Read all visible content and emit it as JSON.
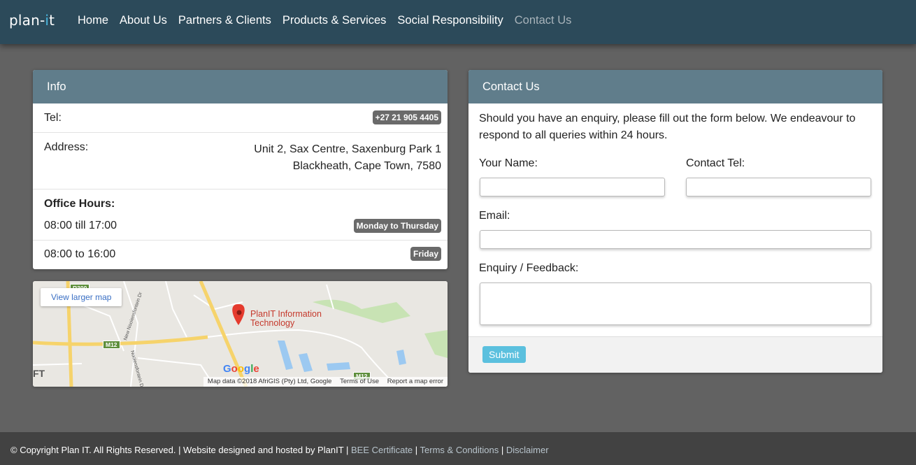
{
  "brand": {
    "logo_text": "plan-",
    "logo_dot": "i",
    "logo_end": "t"
  },
  "nav": [
    {
      "label": "Home"
    },
    {
      "label": "About Us"
    },
    {
      "label": "Partners & Clients"
    },
    {
      "label": "Products & Services"
    },
    {
      "label": "Social Responsibility"
    },
    {
      "label": "Contact Us"
    }
  ],
  "info": {
    "title": "Info",
    "tel_label": "Tel:",
    "tel_value": "+27 21 905 4405",
    "address_label": "Address:",
    "address_line1": "Unit 2, Sax Centre, Saxenburg Park 1",
    "address_line2": "Blackheath, Cape Town, 7580",
    "hours_title": "Office Hours:",
    "hours1_time": "08:00 till 17:00",
    "hours1_days": "Monday to Thursday",
    "hours2_time": "08:00 to 16:00",
    "hours2_days": "Friday"
  },
  "map": {
    "view_larger": "View larger map",
    "place_line1": "PlanIT Information",
    "place_line2": "Technology",
    "google": "Google",
    "attribution": "Map data ©2018 AfriGIS (Pty) Ltd, Google",
    "terms": "Terms of Use",
    "report": "Report a map error",
    "road_m12": "M12",
    "road_m12b": "M12",
    "road_r300": "R300",
    "left_edge": "FT",
    "street1": "New Nooiensfontein Dr",
    "street2": "Nooiensfontein Dr",
    "colors": {
      "road_major": "#f6d36b",
      "road_minor": "#ffffff",
      "water": "#9cc9f1",
      "park": "#c8e3b4",
      "pin": "#e53b2e"
    }
  },
  "contact": {
    "title": "Contact Us",
    "intro": "Should you have an enquiry, please fill out the form below. We endeavour to respond to all queries within 24 hours.",
    "name_label": "Your Name:",
    "tel_label": "Contact Tel:",
    "email_label": "Email:",
    "enquiry_label": "Enquiry / Feedback:",
    "name_value": "",
    "tel_value": "",
    "email_value": "",
    "enquiry_value": "",
    "submit": "Submit"
  },
  "footer": {
    "copyright": "© Copyright Plan IT. All Rights Reserved. | Website designed and hosted by PlanIT |",
    "bee": "BEE Certificate",
    "sep1": " | ",
    "terms": "Terms & Conditions",
    "sep2": " | ",
    "disclaimer": "Disclaimer"
  },
  "colors": {
    "navbar": "#2c4a5a",
    "panel_heading": "#607d8b",
    "background": "#626262",
    "badge": "#6a6a6a",
    "submit": "#5bc0de",
    "footer": "#424242"
  }
}
